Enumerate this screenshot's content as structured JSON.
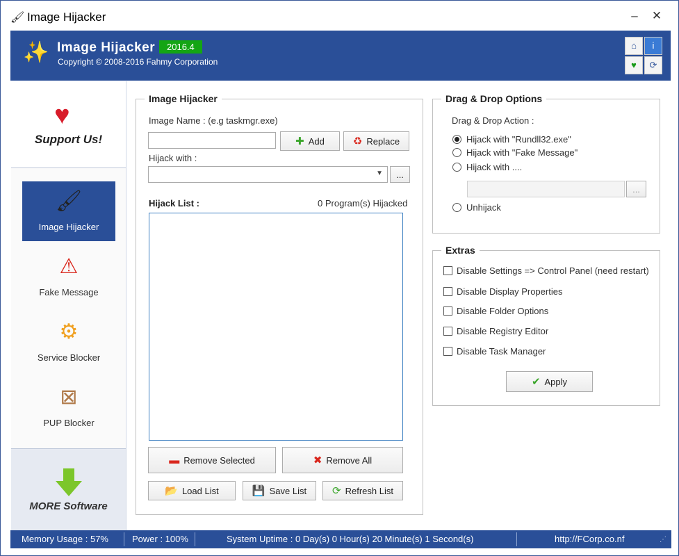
{
  "window": {
    "title": "Image Hijacker",
    "minimize": "–",
    "close": "✕"
  },
  "banner": {
    "app_name": "Image Hijacker",
    "version": "2016.4",
    "copyright": "Copyright © 2008-2016 Fahmy Corporation"
  },
  "sidebar": {
    "support_label": "Support Us!",
    "items": [
      {
        "label": "Image Hijacker",
        "icon": "wand-icon"
      },
      {
        "label": "Fake Message",
        "icon": "warning-icon"
      },
      {
        "label": "Service Blocker",
        "icon": "gear-icon"
      },
      {
        "label": "PUP Blocker",
        "icon": "box-blocked-icon"
      }
    ],
    "more_label": "MORE Software"
  },
  "hijacker": {
    "group_title": "Image Hijacker",
    "image_name_label": "Image Name : (e.g taskmgr.exe)",
    "image_name_value": "",
    "add_label": "Add",
    "replace_label": "Replace",
    "hijack_with_label": "Hijack with :",
    "hijack_with_value": "",
    "browse_label": "...",
    "list_label": "Hijack List :",
    "list_count": "0 Program(s) Hijacked",
    "remove_selected_label": "Remove Selected",
    "remove_all_label": "Remove All",
    "load_list_label": "Load List",
    "save_list_label": "Save List",
    "refresh_list_label": "Refresh List"
  },
  "dragdrop": {
    "group_title": "Drag & Drop Options",
    "action_label": "Drag & Drop Action :",
    "options": [
      {
        "label": "Hijack with \"Rundll32.exe\"",
        "selected": true
      },
      {
        "label": "Hijack with \"Fake Message\"",
        "selected": false
      },
      {
        "label": "Hijack with ....",
        "selected": false
      },
      {
        "label": "Unhijack",
        "selected": false
      }
    ],
    "custom_value": "",
    "browse_label": "..."
  },
  "extras": {
    "group_title": "Extras",
    "checks": [
      {
        "label": "Disable Settings => Control Panel (need restart)",
        "checked": false
      },
      {
        "label": "Disable Display Properties",
        "checked": false
      },
      {
        "label": "Disable Folder Options",
        "checked": false
      },
      {
        "label": "Disable Registry Editor",
        "checked": false
      },
      {
        "label": "Disable Task Manager",
        "checked": false
      }
    ],
    "apply_label": "Apply"
  },
  "status": {
    "memory": "Memory Usage : 57%",
    "power": "Power : 100%",
    "uptime": "System Uptime : 0 Day(s) 0 Hour(s) 20 Minute(s) 1 Second(s)",
    "url": "http://FCorp.co.nf"
  },
  "colors": {
    "brand_blue": "#2a4f98",
    "version_green": "#14a514"
  }
}
